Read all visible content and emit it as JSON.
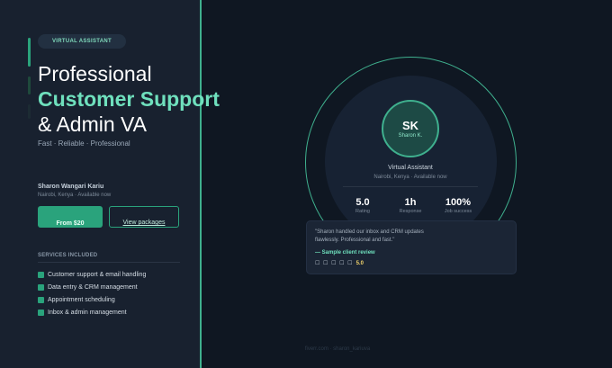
{
  "badge": "VIRTUAL ASSISTANT",
  "headline": {
    "line1": "Professional",
    "line2": "Customer Support",
    "line3": "& Admin VA"
  },
  "tagline": "Fast · Reliable · Professional",
  "person": {
    "name": "Sharon Wangari Kariu",
    "subline": "Nairobi, Kenya · Available now"
  },
  "buttons": {
    "primary": "From $20",
    "secondary": "View packages"
  },
  "services": {
    "title": "SERVICES INCLUDED",
    "items": [
      "Customer support & email handling",
      "Data entry & CRM management",
      "Appointment scheduling",
      "Inbox & admin management"
    ]
  },
  "profile_card": {
    "initials": "SK",
    "short_name": "Sharon K.",
    "role": "Virtual Assistant",
    "location": "Nairobi, Kenya · Available now",
    "stats": [
      {
        "value": "5.0",
        "label": "Rating"
      },
      {
        "value": "1h",
        "label": "Response"
      },
      {
        "value": "100%",
        "label": "Job success"
      }
    ]
  },
  "review": {
    "text": "\"Sharon handled our inbox and CRM updates flawlessly. Professional and fast.\"",
    "source": "— Sample client review",
    "stars": "☐ ☐ ☐ ☐ ☐",
    "score": "5.0"
  },
  "footer": "fiverr.com · sharon_kariuva",
  "colors": {
    "accent": "#2aa37c",
    "headline_highlight": "#6fe0bd",
    "background": "#0f1722",
    "panel": "#18212f"
  }
}
